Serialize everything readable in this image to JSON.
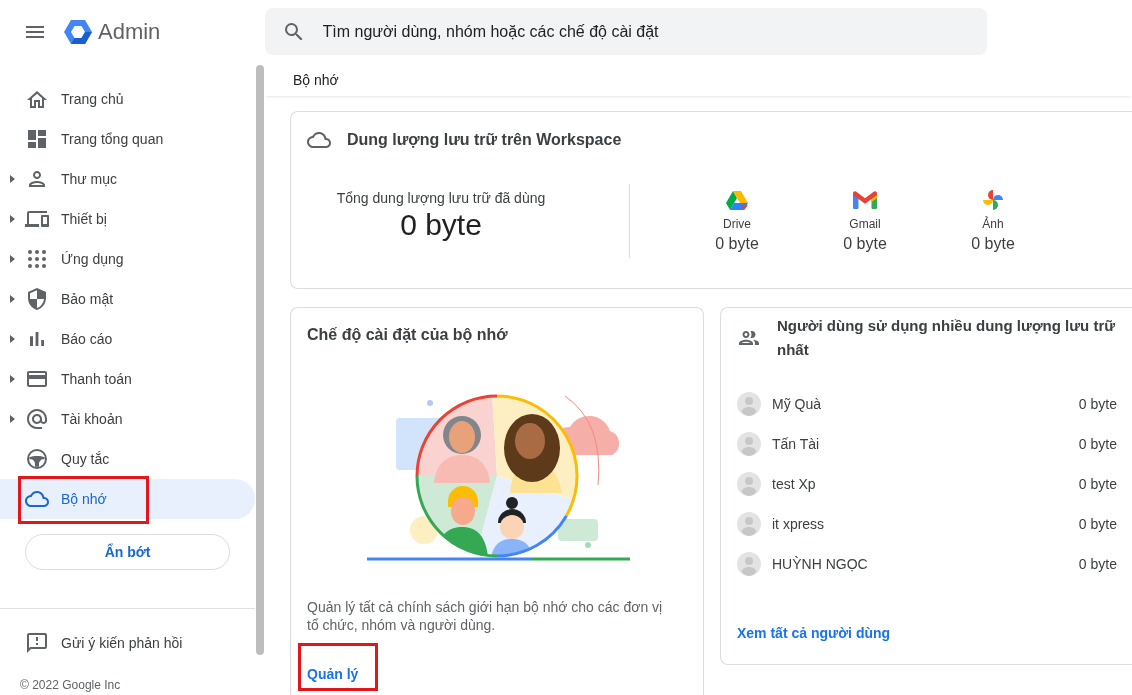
{
  "header": {
    "app_name": "Admin",
    "search": {
      "placeholder": "Tìm người dùng, nhóm hoặc các chế độ cài đặt"
    }
  },
  "sidebar": {
    "items": [
      {
        "kind": "home",
        "label": "Trang chủ",
        "expandable": false,
        "selected": false,
        "highlighted": false
      },
      {
        "kind": "dashboard",
        "label": "Trang tổng quan",
        "expandable": false,
        "selected": false,
        "highlighted": false
      },
      {
        "kind": "directory",
        "label": "Thư mục",
        "expandable": true,
        "selected": false,
        "highlighted": false
      },
      {
        "kind": "devices",
        "label": "Thiết bị",
        "expandable": true,
        "selected": false,
        "highlighted": false
      },
      {
        "kind": "apps",
        "label": "Ứng dụng",
        "expandable": true,
        "selected": false,
        "highlighted": false
      },
      {
        "kind": "security",
        "label": "Bảo mật",
        "expandable": true,
        "selected": false,
        "highlighted": false
      },
      {
        "kind": "reports",
        "label": "Báo cáo",
        "expandable": true,
        "selected": false,
        "highlighted": false
      },
      {
        "kind": "billing",
        "label": "Thanh toán",
        "expandable": true,
        "selected": false,
        "highlighted": false
      },
      {
        "kind": "account",
        "label": "Tài khoản",
        "expandable": true,
        "selected": false,
        "highlighted": false
      },
      {
        "kind": "rules",
        "label": "Quy tắc",
        "expandable": false,
        "selected": false,
        "highlighted": false
      },
      {
        "kind": "storage",
        "label": "Bộ nhớ",
        "expandable": false,
        "selected": true,
        "highlighted": true
      }
    ],
    "collapse_button": "Ẩn bớt",
    "feedback": "Gửi ý kiến phản hồi",
    "copyright": "© 2022 Google Inc"
  },
  "breadcrumb": "Bộ nhớ",
  "workspace_storage": {
    "title": "Dung lượng lưu trữ trên Workspace",
    "total": {
      "label": "Tổng dung lượng lưu trữ đã dùng",
      "value": "0 byte"
    },
    "services": [
      {
        "kind": "drive",
        "name": "Drive",
        "usage": "0 byte"
      },
      {
        "kind": "gmail",
        "name": "Gmail",
        "usage": "0 byte"
      },
      {
        "kind": "photos",
        "name": "Ảnh",
        "usage": "0 byte"
      }
    ]
  },
  "storage_settings": {
    "title": "Chế độ cài đặt của bộ nhớ",
    "description": "Quản lý tất cả chính sách giới hạn bộ nhớ cho các đơn vị tổ chức, nhóm và người dùng.",
    "link": {
      "label": "Quản lý",
      "highlighted": true
    }
  },
  "top_users": {
    "title": "Người dùng sử dụng nhiều dung lượng lưu trữ nhất",
    "users": [
      {
        "name": "Mỹ Quà",
        "usage": "0 byte"
      },
      {
        "name": "Tấn Tài",
        "usage": "0 byte"
      },
      {
        "name": "test Xp",
        "usage": "0 byte"
      },
      {
        "name": "it xpress",
        "usage": "0 byte"
      },
      {
        "name": "HUỲNH NGỌC",
        "usage": "0 byte"
      }
    ],
    "link": "Xem tất cả người dùng"
  }
}
